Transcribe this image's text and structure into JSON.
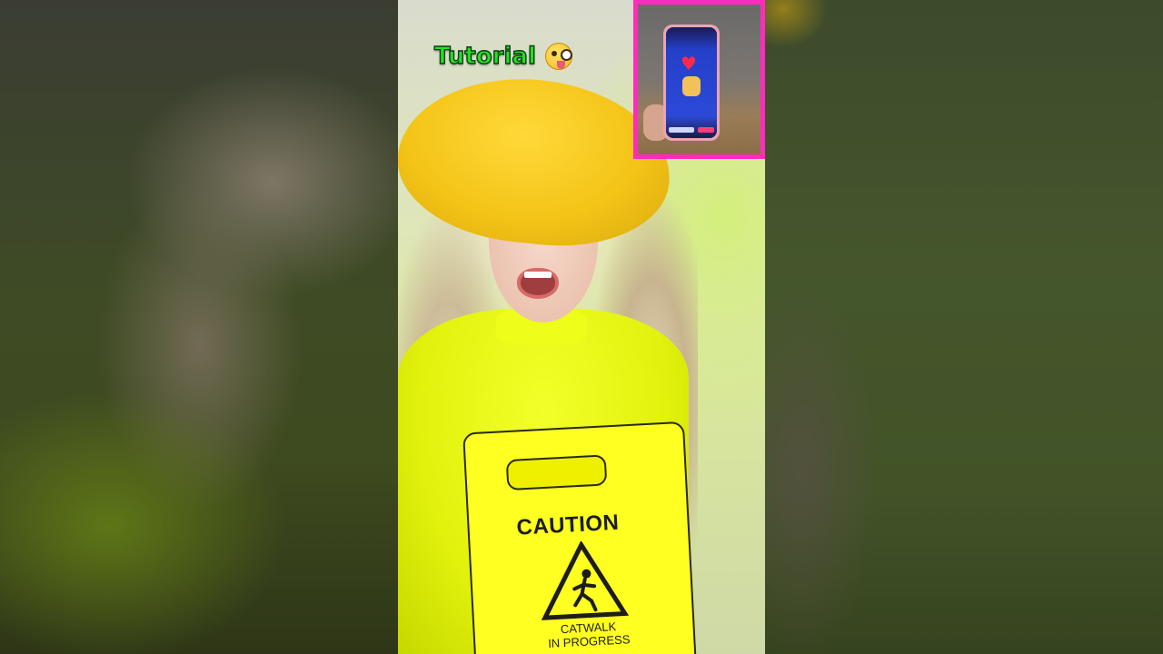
{
  "caption": {
    "text": "Tutorial",
    "emoji": "zany-face-icon",
    "color": "#22e026"
  },
  "sign": {
    "title": "CAUTION",
    "line1": "CATWALK",
    "line2": "IN PROGRESS"
  },
  "pip": {
    "border_color": "#ff2bbd",
    "content": "phone-demo-thumbnail"
  }
}
